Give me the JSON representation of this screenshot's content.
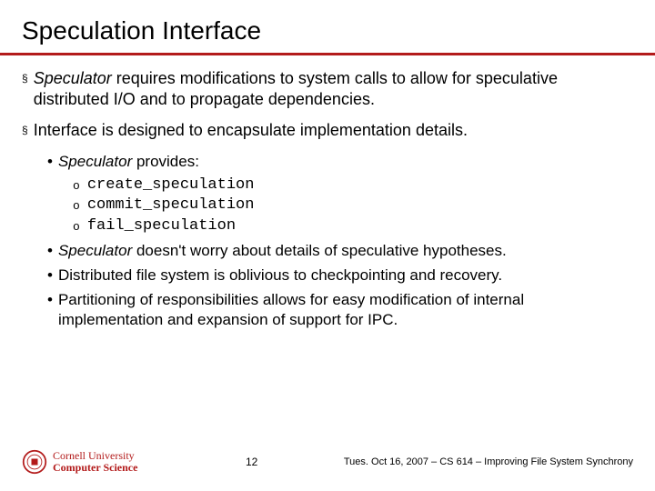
{
  "title": "Speculation Interface",
  "bullets": {
    "b1a_em": "Speculator",
    "b1a_rest": " requires modifications to system calls to allow for speculative distributed I/O and to propagate dependencies.",
    "b1b": "Interface is designed to encapsulate implementation details.",
    "b2a_em": "Speculator",
    "b2a_rest": " provides:",
    "b3a": "create_speculation",
    "b3b": "commit_speculation",
    "b3c": "fail_speculation",
    "b2b_em": "Speculator",
    "b2b_rest": " doesn't worry about details of speculative hypotheses.",
    "b2c": "Distributed file system is oblivious to checkpointing and recovery.",
    "b2d": "Partitioning of responsibilities allows for easy modification of internal implementation and expansion of support for IPC."
  },
  "logo": {
    "line1": "Cornell University",
    "line2": "Computer Science"
  },
  "page_number": "12",
  "footer_text": "Tues. Oct 16, 2007 – CS 614 – Improving File System Synchrony",
  "marks": {
    "l1": "§",
    "l2": "•",
    "l3": "o"
  }
}
